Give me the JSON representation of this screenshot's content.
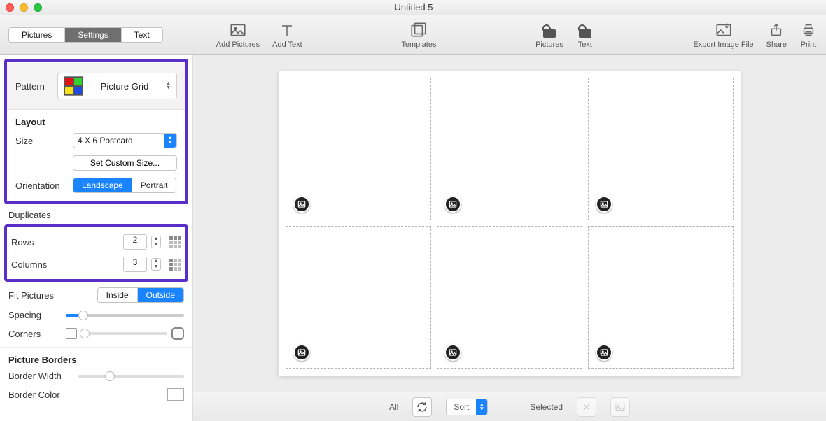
{
  "window": {
    "title": "Untitled 5"
  },
  "tabs": {
    "pictures": "Pictures",
    "settings": "Settings",
    "text": "Text",
    "active": "settings"
  },
  "toolbar": {
    "add_pictures": "Add Pictures",
    "add_text": "Add Text",
    "templates": "Templates",
    "pictures": "Pictures",
    "text": "Text",
    "export": "Export Image File",
    "share": "Share",
    "print": "Print"
  },
  "sidebar": {
    "pattern": {
      "label": "Pattern",
      "value": "Picture Grid"
    },
    "layout": {
      "heading": "Layout",
      "size_label": "Size",
      "size_value": "4 X 6 Postcard",
      "custom_size_btn": "Set Custom Size...",
      "orientation_label": "Orientation",
      "orientation_landscape": "Landscape",
      "orientation_portrait": "Portrait",
      "orientation_value": "Landscape"
    },
    "duplicates_label": "Duplicates",
    "grid": {
      "rows_label": "Rows",
      "rows_value": "2",
      "cols_label": "Columns",
      "cols_value": "3"
    },
    "fit": {
      "label": "Fit Pictures",
      "inside": "Inside",
      "outside": "Outside",
      "value": "Outside"
    },
    "spacing_label": "Spacing",
    "spacing_value_pct": 15,
    "corners_label": "Corners",
    "borders": {
      "heading": "Picture Borders",
      "width_label": "Border Width",
      "width_value_pct": 30,
      "color_label": "Border Color"
    }
  },
  "bottom": {
    "all_label": "All",
    "sort_label": "Sort",
    "selected_label": "Selected"
  },
  "canvas": {
    "rows": 2,
    "cols": 3
  }
}
